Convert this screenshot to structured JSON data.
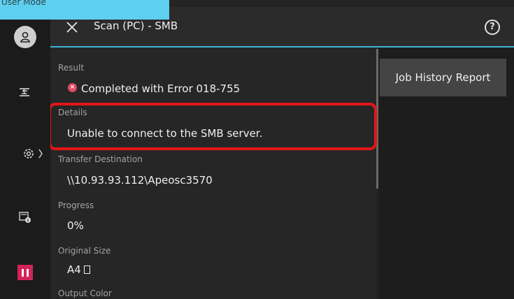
{
  "mode_tab": {
    "label": "User Mode"
  },
  "header": {
    "title": "Scan (PC) - SMB",
    "help_label": "?"
  },
  "rail": {
    "icons": [
      "user-icon",
      "job-status-icon",
      "settings-icon",
      "printer-info-icon",
      "pause-icon"
    ]
  },
  "details": {
    "result_label": "Result",
    "result_value": "Completed with Error 018-755",
    "details_label": "Details",
    "details_value": "Unable to connect to the SMB server.",
    "destination_label": "Transfer Destination",
    "destination_value": "\\\\10.93.93.112\\Apeosc3570",
    "progress_label": "Progress",
    "progress_value": "0%",
    "original_size_label": "Original Size",
    "original_size_value": "A4",
    "output_color_label": "Output Color"
  },
  "side": {
    "report_button": "Job History Report"
  },
  "colors": {
    "accent": "#3fb2d9",
    "error": "#df4a64",
    "highlight": "#e41516",
    "pause": "#d1245c"
  }
}
